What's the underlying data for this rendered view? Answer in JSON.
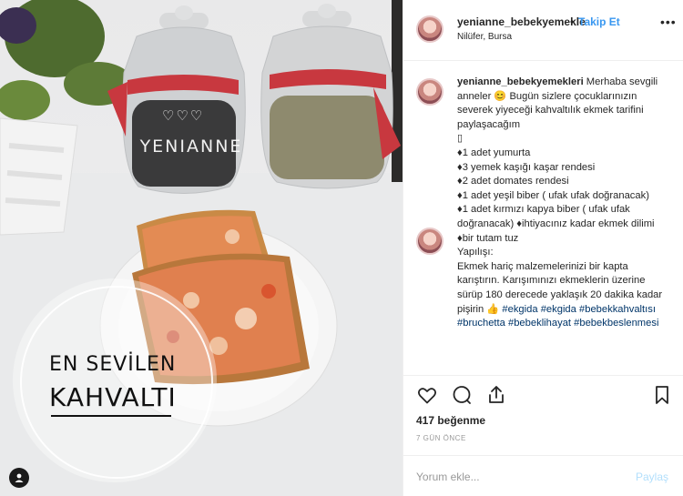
{
  "photo": {
    "brand_text": "YENIANNE",
    "hearts": "♡♡♡",
    "badge_line1": "EN SEVİLEN",
    "badge_line2": "KAHVALTI"
  },
  "post": {
    "username": "yenianne_bebekyemekle",
    "dot": "•",
    "follow_label": "Takip Et",
    "location": "Nilüfer, Bursa",
    "more_label": "•••"
  },
  "caption": {
    "author": "yenianne_bebekyemekleri",
    "intro": "Merhaba sevgili anneler 😊 Bugün sizlere çocuklarınızın severek yiyeceği kahvaltılık ekmek tarifini paylaşacağım",
    "box_char": "▯",
    "ingredients": [
      "♦1 adet yumurta",
      "♦3 yemek kaşığı kaşar rendesi",
      "♦2 adet domates rendesi",
      "♦1 adet yeşil biber ( ufak ufak doğranacak)",
      "♦1 adet kırmızı kapya biber ( ufak ufak doğranacak) ♦ihtiyacınız kadar ekmek dilimi ♦bir tutam tuz"
    ],
    "method_title": "Yapılışı:",
    "method": "Ekmek hariç malzemelerinizi bir kapta karıştırın. Karışımınızı ekmeklerin üzerine sürüp 180 derecede yaklaşık 20 dakika kadar pişirin 👍",
    "hashtags": [
      "#ekgida",
      "#ekgida",
      "#bebekkahvaltısı",
      "#bruchetta",
      "#bebeklihayat",
      "#bebekbeslenmesi"
    ]
  },
  "footer": {
    "likes": "417 beğenme",
    "time_ago": "7 GÜN ÖNCE",
    "comment_placeholder": "Yorum ekle...",
    "share_label": "Paylaş"
  },
  "colors": {
    "link": "#3897f0",
    "hashtag": "#003569",
    "muted": "#999999",
    "share_disabled": "#b2dffc"
  }
}
